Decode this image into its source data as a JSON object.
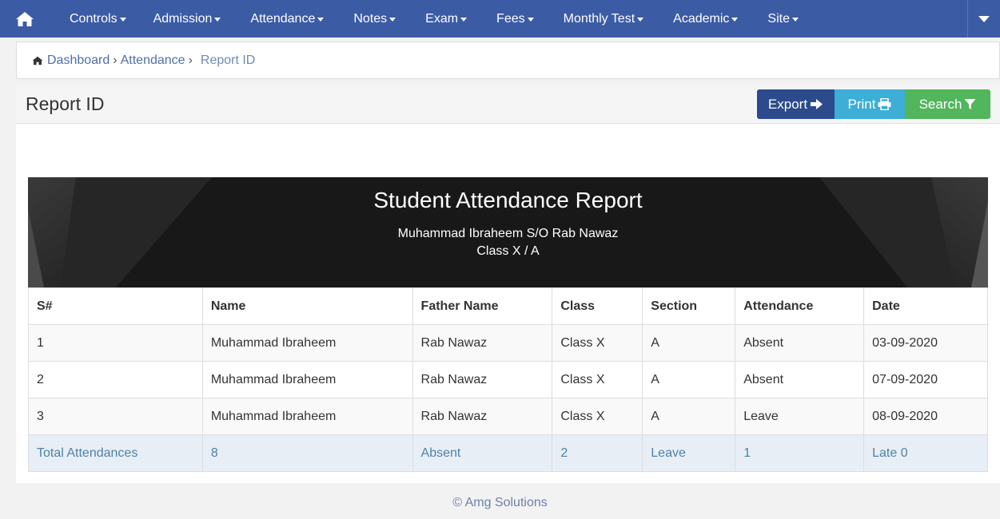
{
  "navbar": {
    "items": [
      {
        "label": "Controls"
      },
      {
        "label": "Admission"
      },
      {
        "label": "Attendance"
      },
      {
        "label": "Notes"
      },
      {
        "label": "Exam"
      },
      {
        "label": "Fees"
      },
      {
        "label": "Monthly Test"
      },
      {
        "label": "Academic"
      },
      {
        "label": "Site"
      }
    ],
    "home_icon": "home-icon",
    "bg_color": "#3b5ba5"
  },
  "breadcrumb": {
    "home": "Dashboard",
    "section": "Attendance",
    "sep": "›",
    "current": "Report ID"
  },
  "panel": {
    "title": "Report ID",
    "buttons": {
      "export": "Export",
      "print": "Print",
      "search": "Search"
    }
  },
  "report": {
    "title": "Student Attendance Report",
    "student": "Muhammad Ibraheem S/O Rab Nawaz",
    "class_section": "Class X / A",
    "columns": [
      "S#",
      "Name",
      "Father Name",
      "Class",
      "Section",
      "Attendance",
      "Date"
    ],
    "rows": [
      [
        "1",
        "Muhammad Ibraheem",
        "Rab Nawaz",
        "Class X",
        "A",
        "Absent",
        "03-09-2020"
      ],
      [
        "2",
        "Muhammad Ibraheem",
        "Rab Nawaz",
        "Class X",
        "A",
        "Absent",
        "07-09-2020"
      ],
      [
        "3",
        "Muhammad Ibraheem",
        "Rab Nawaz",
        "Class X",
        "A",
        "Leave",
        "08-09-2020"
      ]
    ],
    "totals": [
      "Total Attendances",
      "8",
      "Absent",
      "2",
      "Leave",
      "1",
      "Late 0"
    ]
  },
  "footer": {
    "text": "© Amg Solutions"
  }
}
